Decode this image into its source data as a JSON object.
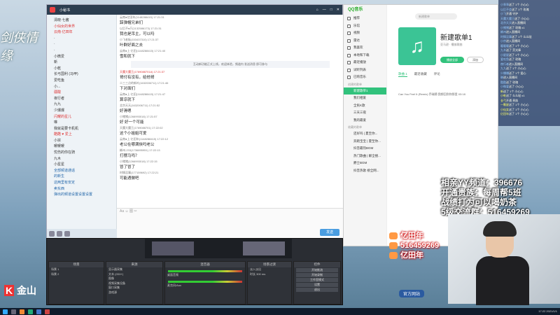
{
  "overlay_left": {
    "brand": "金山"
  },
  "yy": {
    "title": "小秘书",
    "tree": [
      {
        "label": "清晓·七酱",
        "style": ""
      },
      {
        "label": "小仙女的世界",
        "style": "red"
      },
      {
        "label": "云南·亿田年",
        "style": "red"
      },
      {
        "label": "·",
        "style": ""
      },
      {
        "label": "·",
        "style": ""
      },
      {
        "label": "·",
        "style": ""
      },
      {
        "label": "小微爱",
        "style": ""
      },
      {
        "label": "新",
        "style": ""
      },
      {
        "label": "小乾",
        "style": ""
      },
      {
        "label": "长弓国利 (马甲)",
        "style": ""
      },
      {
        "label": "爱吃鱼",
        "style": ""
      },
      {
        "label": "小...",
        "style": ""
      },
      {
        "label": "疆酸",
        "style": "red"
      },
      {
        "label": "夜行者",
        "style": ""
      },
      {
        "label": "九九",
        "style": ""
      },
      {
        "label": "少爆爆",
        "style": ""
      },
      {
        "label": "闪耀的星儿",
        "style": "red"
      },
      {
        "label": "琳",
        "style": ""
      },
      {
        "label": "我就是要卡机机",
        "style": ""
      },
      {
        "label": "酷酷 ♥ 爱上",
        "style": "red"
      },
      {
        "label": "小宗",
        "style": ""
      },
      {
        "label": "暖暖暖",
        "style": ""
      },
      {
        "label": "忧伤的你在骑",
        "style": ""
      },
      {
        "label": "九木",
        "style": ""
      },
      {
        "label": "小星星",
        "style": ""
      },
      {
        "label": "全部频道通话",
        "style": "blue"
      },
      {
        "label": "的新生",
        "style": "blue"
      },
      {
        "label": "这两里有安定",
        "style": "blue"
      },
      {
        "label": "卖东西",
        "style": "blue"
      },
      {
        "label": "弹出的频道设置设置设置",
        "style": "blue"
      }
    ],
    "messages": [
      {
        "meta": "云南●亿田年(1148288415) 17:21:31",
        "text": "踩弹帽兄弟们",
        "red": false
      },
      {
        "meta": "以后不●只(1132586173) 17:21:31",
        "text": "我也是吊主，可以吗",
        "red": false
      },
      {
        "meta": "小飞老板(153437310) 17:21:37",
        "text": "叶群好面之去",
        "red": false
      },
      {
        "meta": "云南●上·亿田(1148288415) 17:21:40",
        "text": "雪和就下",
        "red": false
      },
      {
        "meta": "天魔大魔王(1769088701A) 17:21:37",
        "text": "哥付有没有，给他哥",
        "red": true
      },
      {
        "meta": "二三三点的新叶(1632006711) 17:21:46",
        "text": "下对面们",
        "red": false
      },
      {
        "meta": "云南●上·亿田(1148288415) 17:21:47",
        "text": "算凉就下",
        "red": false
      },
      {
        "meta": "北京天天(1632006711) 17:21:52",
        "text": "好滑嗯",
        "red": false
      },
      {
        "meta": "小猪猪(1266993018) 17:21:57",
        "text": "好 好一个可能",
        "red": false
      },
      {
        "meta": "天魔大魔王(1769088701) 17:22:02",
        "text": "这个小姐姐可爱",
        "red": false
      },
      {
        "meta": "云南●上·亿田年(1148288415) 17:22:12",
        "text": "老公在哪满侠吗老公",
        "red": false
      },
      {
        "meta": "郴州-233(1736895951) 17:22:13",
        "text": "打摆马吗？",
        "red": false
      },
      {
        "meta": "小猪猪(1266993018) 17:22:15",
        "text": "冒了冒了",
        "red": false
      },
      {
        "meta": "时情没事(177159692) 17:22:21",
        "text": "可能遇做吧",
        "red": false
      }
    ],
    "notice": "互动新功能正式上线，欢迎体验，频道内 发送消息 即可参与",
    "send_label": "发送",
    "input_hint": "Aa ☺ 图 ✂"
  },
  "obs": {
    "docks": [
      {
        "title": "场景",
        "rows": [
          "场景 1",
          "场景 2"
        ]
      },
      {
        "title": "来源",
        "rows": [
          "显示器采集",
          "文本 (GDI+)",
          "图像",
          "视频采集设备",
          "窗口采集",
          "游戏源"
        ]
      },
      {
        "title": "混音器",
        "rows": [
          "桌面音频",
          "麦克风/Aux"
        ]
      },
      {
        "title": "场景过渡",
        "rows": [
          "淡入淡出",
          "时长 300 ms"
        ]
      },
      {
        "title": "控件",
        "rows": [
          "开始推流",
          "开始录制",
          "工作室模式",
          "设置",
          "退出"
        ]
      }
    ],
    "status": "LIVE: 00:00:00  REC: 00:00:00  CPU: 7.4%, 30.00 fps"
  },
  "qq": {
    "logo": "QQ音乐",
    "search_placeholder": "新建歌单",
    "nav": [
      {
        "label": "推荐",
        "active": false
      },
      {
        "label": "乐馆",
        "active": false
      },
      {
        "label": "视频",
        "active": false
      },
      {
        "label": "雷达",
        "active": false
      },
      {
        "label": "我喜欢",
        "active": false
      },
      {
        "label": "本地和下载",
        "active": false
      },
      {
        "label": "最近播放",
        "active": false
      },
      {
        "label": "试听列表",
        "active": false
      },
      {
        "label": "已购音乐",
        "active": false
      }
    ],
    "created_header": "创建的歌单",
    "playlists": [
      {
        "label": "新建歌单1",
        "active": true
      },
      {
        "label": "我们相爱",
        "active": false
      },
      {
        "label": "全民K歌",
        "active": false
      },
      {
        "label": "三天三夜",
        "active": false
      },
      {
        "label": "我的最爱",
        "active": false
      }
    ],
    "collected_header": "收藏的歌单",
    "collected": [
      "还好吗 | 夏至你...",
      "奔跑宝宝 | 夏至你...",
      "抖音最热BGM",
      "热门歌曲 | 解全搜...",
      "爵士BGM",
      "抖音热歌 榜全网..."
    ],
    "playlist_title": "新建歌单1",
    "playlist_sub": "亚马逊   · 播放歌曲",
    "play_all": "播放全部",
    "add": "添加",
    "tabs": [
      "歌曲 1",
      "最近收藏",
      "评论"
    ],
    "song": "Can You Feel It (Remix)   乔瑞德  我想回到你那里  03:18"
  },
  "right_log": [
    {
      "name": "小乖乖",
      "text": "送了 1个 小心心",
      "yellow": false
    },
    {
      "name": "以后不会",
      "text": "送了 1个 玫瑰",
      "yellow": false
    },
    {
      "name": "小飞",
      "text": "开通 守护",
      "yellow": false
    },
    {
      "name": "天魔大魔王",
      "text": "送了 小心心",
      "yellow": false
    },
    {
      "name": "北京天天",
      "text": "进入直播间",
      "yellow": false
    },
    {
      "name": "小猪猪",
      "text": "送了 玫瑰 x1",
      "yellow": false
    },
    {
      "name": "郴州",
      "text": "进入直播间",
      "yellow": false
    },
    {
      "name": "时情没事",
      "text": "送了 1个 么么哒",
      "yellow": false
    },
    {
      "name": "小宗",
      "text": "进入直播间",
      "yellow": false
    },
    {
      "name": "暖暖暖",
      "text": "送了 1个 小心心",
      "yellow": false
    },
    {
      "name": "九木",
      "text": "送了 荧光棒",
      "yellow": false
    },
    {
      "name": "小星星",
      "text": "送了 1个 小心心",
      "yellow": false
    },
    {
      "name": "爱吃鱼",
      "text": "送了 玫瑰",
      "yellow": false
    },
    {
      "name": "夜行者",
      "text": "进入直播间",
      "yellow": false
    },
    {
      "name": "九九",
      "text": "送了 1个 小心心",
      "yellow": false
    },
    {
      "name": "少爆爆",
      "text": "送了 1个 爱心",
      "yellow": false
    },
    {
      "name": "琳",
      "text": "进入直播间",
      "yellow": false
    },
    {
      "name": "酷酷",
      "text": "送了 玫瑰",
      "yellow": false
    },
    {
      "name": "小微爱",
      "text": "送了 小心心",
      "yellow": false
    },
    {
      "name": "新",
      "text": "送了 1个 小心心",
      "yellow": true
    },
    {
      "name": "小乾",
      "text": "送了 么么哒 x1",
      "yellow": true
    },
    {
      "name": "长弓",
      "text": "开通 贵族",
      "yellow": true
    },
    {
      "name": "一颗星",
      "text": "送了 1个 小心心",
      "yellow": true
    },
    {
      "name": "小仙女",
      "text": "送了 1个 小心心",
      "yellow": true
    },
    {
      "name": "亿田年",
      "text": "送了 1个 小心心",
      "yellow": true
    }
  ],
  "overlay": {
    "line1": "相亲YY频道：396676",
    "line2": "开通贵族：每周帮5班",
    "line3": "战绩打为可以喝奶茶",
    "line4": "5级交流群：516459269"
  },
  "gifts": [
    {
      "text": "亿田年"
    },
    {
      "text": "516459269"
    },
    {
      "text": "亿田年"
    }
  ],
  "gift_footer": "官方网站",
  "taskbar": {
    "time": "17:22",
    "date": "2021/1/1"
  }
}
